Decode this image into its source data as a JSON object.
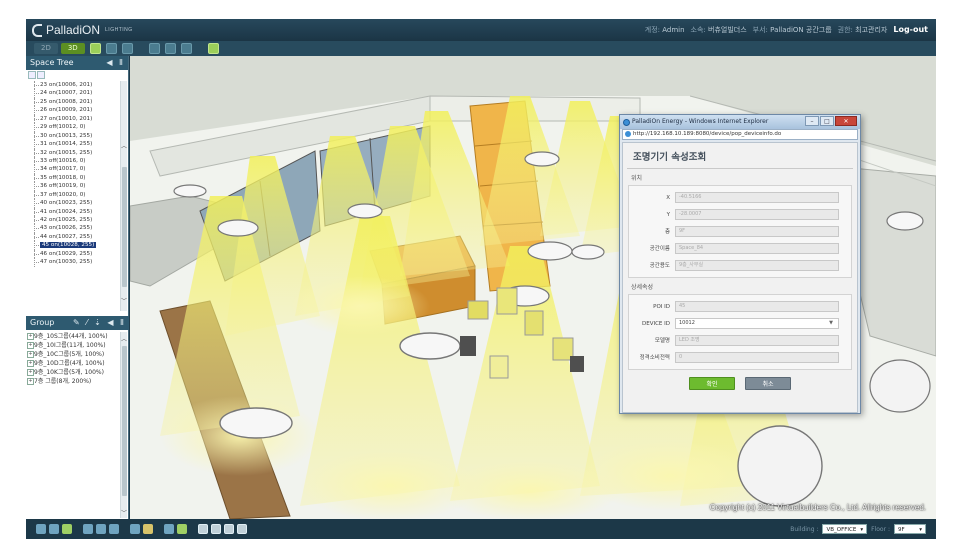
{
  "app": {
    "brand": "PalladiON",
    "brand_sub": "LIGHTING"
  },
  "header": {
    "account_label": "계정:",
    "account": "Admin",
    "company_label": "소속:",
    "company": "버츄얼빌더스",
    "division_label": "부서:",
    "division": "PalladiON 공간그룹",
    "role_label": "권한:",
    "role": "최고관리자",
    "logout": "Log-out"
  },
  "toolbar": {
    "tab_2d": "2D",
    "tab_3d": "3D"
  },
  "space_tree": {
    "title": "Space Tree",
    "tools": "◀ Ⅱ",
    "items": [
      "23 on(10006, 201)",
      "24 on(10007, 201)",
      "25 on(10008, 201)",
      "26 on(10009, 201)",
      "27 on(10010, 201)",
      "29 off(10012, 0)",
      "30 on(10013, 255)",
      "31 on(10014, 255)",
      "32 on(10015, 255)",
      "33 off(10016, 0)",
      "34 off(10017, 0)",
      "35 off(10018, 0)",
      "36 off(10019, 0)",
      "37 off(10020, 0)",
      "40 on(10023, 255)",
      "41 on(10024, 255)",
      "42 on(10025, 255)",
      "43 on(10026, 255)",
      "44 on(10027, 255)",
      "45 on(10028, 255)",
      "46 on(10029, 255)",
      "47 on(10030, 255)"
    ],
    "selected_index": 19
  },
  "group": {
    "title": "Group",
    "tools": "✎ ⁄ ⇣ ◀ Ⅱ",
    "items": [
      "9층_10S그룹(44개, 100%)",
      "9층_10I그룹(11개, 100%)",
      "9층_10C그룹(5개, 100%)",
      "9층_10D그룹(4개, 100%)",
      "9층_10K그룹(5개, 100%)",
      "7층 그룹(8개, 200%)"
    ]
  },
  "dialog": {
    "window_title": "PalladiOn Energy - Windows Internet Explorer",
    "url": "http://192.168.10.189:8080/device/pop_deviceinfo.do",
    "heading": "조명기기 속성조회",
    "section_location": "위치",
    "section_detail": "상세속성",
    "fields_location": [
      {
        "label": "X",
        "value": "-40.5166"
      },
      {
        "label": "Y",
        "value": "-28.0007"
      },
      {
        "label": "층",
        "value": "9F"
      },
      {
        "label": "공간이름",
        "value": "Space_84"
      },
      {
        "label": "공간용도",
        "value": "9층_사무실"
      }
    ],
    "fields_detail": [
      {
        "label": "POI ID",
        "value": "45"
      },
      {
        "label": "DEVICE ID",
        "value": "10012"
      },
      {
        "label": "모델명",
        "value": "LED 조명"
      },
      {
        "label": "정격소비전력",
        "value": "0"
      }
    ],
    "ok": "확인",
    "cancel": "취소"
  },
  "footer": {
    "copyright": "Copyright (c) 2011 Virtualbuilders Co., Ltd. Allrights reserved.",
    "building_label": "Building :",
    "building": "VB_OFFICE",
    "floor_label": "Floor :",
    "floor": "9F"
  }
}
